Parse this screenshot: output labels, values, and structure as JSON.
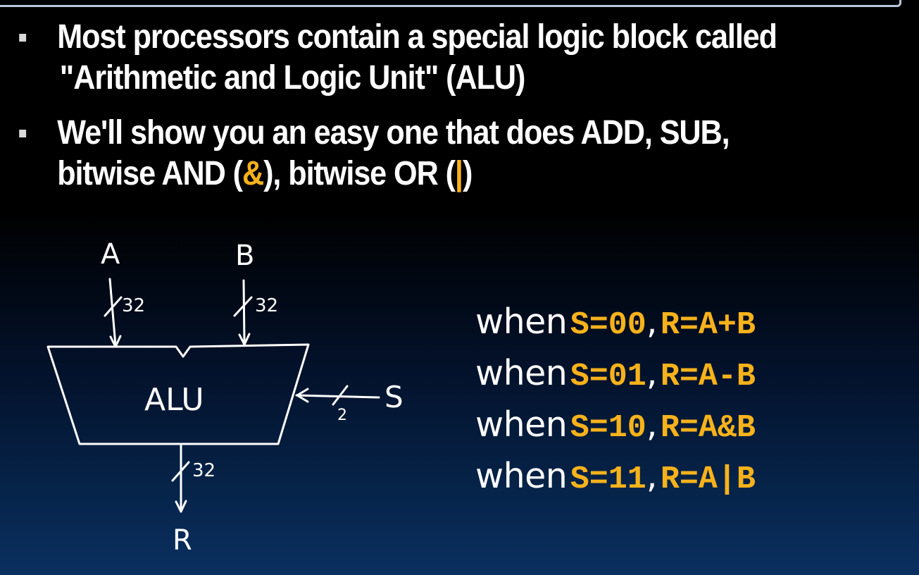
{
  "bullets": [
    {
      "line1": "Most processors contain a special logic block called",
      "line2": "\"Arithmetic and Logic Unit\" (ALU)"
    },
    {
      "line1": "We'll show you an easy one that does ADD, SUB,",
      "line2_a": "bitwise AND (",
      "and_symbol": "&",
      "line2_b": "), bitwise OR (",
      "or_symbol": "|",
      "line2_c": ")"
    }
  ],
  "diagram": {
    "block_label": "ALU",
    "input_a": "A",
    "input_b": "B",
    "select": "S",
    "output": "R",
    "width_a": "32",
    "width_b": "32",
    "width_s": "2",
    "width_r": "32"
  },
  "operations": [
    {
      "when": "when",
      "select": "S=00",
      "comma": ",",
      "result": "R=A+B"
    },
    {
      "when": "when",
      "select": "S=01",
      "comma": ",",
      "result": "R=A-B"
    },
    {
      "when": "when",
      "select": "S=10",
      "comma": ",",
      "result": "R=A&B"
    },
    {
      "when": "when",
      "select": "S=11",
      "comma": ",",
      "result": "R=A|B"
    }
  ],
  "colors": {
    "accent": "#f7b21b",
    "text": "#ffffff",
    "background_top": "#000000",
    "background_bottom": "#0a3060"
  }
}
